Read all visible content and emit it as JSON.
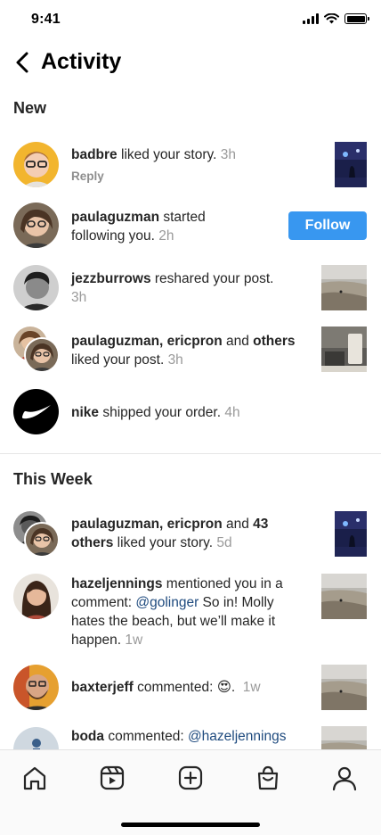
{
  "status_bar": {
    "time": "9:41"
  },
  "header": {
    "title": "Activity",
    "back_icon": "chevron-left-icon"
  },
  "sections": {
    "new": "New",
    "this_week": "This Week"
  },
  "new_items": [
    {
      "user": "badbre",
      "text": " liked your story.",
      "time": "3h",
      "reply": "Reply"
    },
    {
      "user": "paulaguzman",
      "text_line1": " started",
      "text_line2": "following you.",
      "time": "2h",
      "button": "Follow"
    },
    {
      "user": "jezzburrows",
      "text": " reshared your post.",
      "time": "3h"
    },
    {
      "user": "paulaguzman, ericpron",
      "and": " and ",
      "others": "others",
      "text_line2": "liked your post.",
      "time": "3h"
    },
    {
      "user": "nike",
      "text": " shipped your order.",
      "time": "4h"
    }
  ],
  "week_items": [
    {
      "user": "paulaguzman, ericpron",
      "and": " and ",
      "others": "43",
      "line2_bold": "others",
      "line2": " liked your story.",
      "time": "5d"
    },
    {
      "user": "hazeljennings",
      "line1": " mentioned you in a",
      "line2_prefix": "comment: ",
      "mention": "@golinger",
      "line2_suffix": " So in! Molly",
      "line3": "hates the beach, but we’ll make it",
      "line4": "happen.",
      "time": "1w"
    },
    {
      "user": "baxterjeff",
      "text": " commented: ",
      "emoji": "😍",
      "dot": ".",
      "time": "1w"
    },
    {
      "user": "boda",
      "text": " commented: ",
      "mention": "@hazeljennings"
    }
  ],
  "tabs": [
    "home-icon",
    "reels-icon",
    "create-icon",
    "shop-icon",
    "profile-icon"
  ],
  "colors": {
    "accent": "#3897f0",
    "mention": "#1e4a7e",
    "timestamp": "#9a9a9a"
  }
}
